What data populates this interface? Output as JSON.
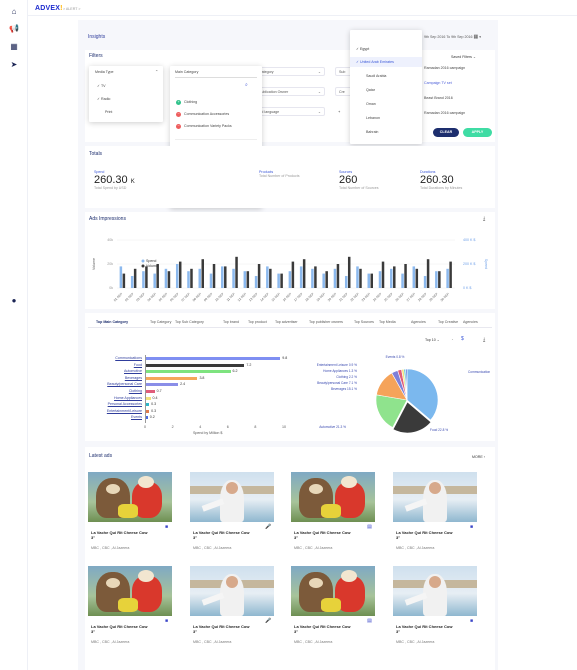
{
  "app": {
    "logo_main": "ADVEX",
    "logo_accent": "!",
    "crumb": "> ALERT >"
  },
  "sidebar": {
    "icons": [
      "home-icon",
      "megaphone-icon",
      "grid-icon",
      "send-icon",
      "user-icon"
    ]
  },
  "header": {
    "title": "Insights",
    "country": "EGYPT",
    "date_range": "9th Sep 2016 To 9th Sep 2016",
    "filters_title": "Filters",
    "saved_filters_title": "Saved Filters",
    "saved_filters": [
      "Ramadan 2016 campaign",
      "Campaign TV set",
      "Beast Brand 2016",
      "Ramadan 2016 campaign"
    ],
    "clear_label": "CLEAR",
    "apply_label": "APPLY"
  },
  "country_dd": {
    "items": [
      {
        "label": "Egypt",
        "checked": true
      },
      {
        "label": "United Arab Emirates",
        "checked": true
      },
      {
        "label": "Saudi Arabia",
        "checked": false
      },
      {
        "label": "Qatar",
        "checked": false
      },
      {
        "label": "Oman",
        "checked": false
      },
      {
        "label": "Lebanon",
        "checked": false
      },
      {
        "label": "Bahrain",
        "checked": false
      }
    ]
  },
  "media_type": {
    "label": "Media Type",
    "options": [
      {
        "label": "TV",
        "checked": true
      },
      {
        "label": "Radio",
        "checked": true
      },
      {
        "label": "Print",
        "checked": false
      }
    ]
  },
  "main_category": {
    "label": "Main Category",
    "selected": [
      {
        "label": "Clothing",
        "state": "include"
      },
      {
        "label": "Communication Accessories",
        "state": "exclude"
      },
      {
        "label": "Communication Variety Packs",
        "state": "exclude"
      }
    ],
    "list": [
      "Clothing",
      "Communication Accessories",
      "Communication Variety Packs",
      "Fixed Communication Devices",
      "Mobile Communication Devices"
    ]
  },
  "filter_pills": [
    "Category",
    "Publication Owner",
    "Ad language",
    "Sub",
    "Cre"
  ],
  "totals": {
    "title": "Totals",
    "items": [
      {
        "label": "Spend",
        "value": "260.30",
        "unit": "K",
        "sub": "Total Spend by USD"
      },
      {
        "label": "Products",
        "value": "",
        "unit": "",
        "sub": "Total Number of Products"
      },
      {
        "label": "Sources",
        "value": "260",
        "unit": "",
        "sub": "Total Number of Sources"
      },
      {
        "label": "Durations",
        "value": "260.30",
        "unit": "",
        "sub": "Total Durations by Minutes"
      }
    ]
  },
  "impressions": {
    "title": "Ads Impressions",
    "y_left_label": "Volume",
    "y_right_label": "Spend",
    "left_ticks": [
      "40k",
      "20k",
      "0k"
    ],
    "right_ticks": [
      "400 K $",
      "200 K $",
      "0 K $"
    ],
    "legend": [
      "Spend",
      "Volume"
    ],
    "x_labels": [
      "01 SEP",
      "02 SEP",
      "03 SEP",
      "04 SEP",
      "05 SEP",
      "06 SEP",
      "07 SEP",
      "08 SEP",
      "09 SEP",
      "10 SEP",
      "11 SEP",
      "12 SEP",
      "13 SEP",
      "14 SEP",
      "15 SEP",
      "16 SEP",
      "17 SEP",
      "18 SEP",
      "19 SEP",
      "20 SEP",
      "21 SEP",
      "22 SEP",
      "23 SEP",
      "24 SEP",
      "25 SEP",
      "26 SEP",
      "27 SEP",
      "28 SEP",
      "29 SEP",
      "30 SEP"
    ],
    "spend": [
      18,
      10,
      14,
      12,
      16,
      20,
      14,
      16,
      12,
      18,
      16,
      14,
      10,
      18,
      12,
      14,
      18,
      16,
      12,
      16,
      10,
      18,
      12,
      14,
      16,
      12,
      18,
      10,
      14,
      16
    ],
    "volume": [
      12,
      16,
      18,
      20,
      14,
      22,
      16,
      24,
      20,
      18,
      26,
      14,
      20,
      16,
      12,
      22,
      24,
      18,
      14,
      20,
      26,
      16,
      12,
      22,
      18,
      20,
      16,
      24,
      14,
      22
    ]
  },
  "tabs": [
    "Top Main Category",
    "Top Category",
    "Top Sub Category",
    "Top brand",
    "Top product",
    "Top advertiser",
    "Top publisher owners",
    "Top Sources",
    "Top Media",
    "Agencies",
    "Top Creative",
    "Agencies"
  ],
  "top_selector": "Top 10",
  "hbar_chart": {
    "xlabel": "Spend by Million $",
    "ticks": [
      "0",
      "2",
      "4",
      "6",
      "8",
      "10"
    ],
    "items": [
      {
        "label": "Communications",
        "value": 9.8,
        "color": "#7f8ff2"
      },
      {
        "label": "Food",
        "value": 7.2,
        "color": "#3a3a3a"
      },
      {
        "label": "Automotive",
        "value": 6.2,
        "color": "#7ee37f"
      },
      {
        "label": "Beverages",
        "value": 3.8,
        "color": "#f5a75a"
      },
      {
        "label": "Beauty/personal Care",
        "value": 2.4,
        "color": "#8a8ee8"
      },
      {
        "label": "Clothing",
        "value": 0.7,
        "color": "#e05d7a"
      },
      {
        "label": "Home Appliances",
        "value": 0.4,
        "color": "#f3e27c"
      },
      {
        "label": "Personal Accessories",
        "value": 0.3,
        "color": "#2fb5c8"
      },
      {
        "label": "Entertainment/Leisure",
        "value": 0.3,
        "color": "#e07b4e"
      },
      {
        "label": "Events",
        "value": 0.2,
        "color": "#4c6adf"
      }
    ]
  },
  "pie_chart": {
    "slices": [
      {
        "label": "Communications 38.6 %",
        "value": 38.6,
        "color": "#7bb8ee"
      },
      {
        "label": "Food 22.8 %",
        "value": 22.8,
        "color": "#3a3a3a"
      },
      {
        "label": "Automotive 21.3 %",
        "value": 21.3,
        "color": "#8fe38d"
      },
      {
        "label": "Beverages 15.1 %",
        "value": 15.1,
        "color": "#f5a35a"
      },
      {
        "label": "Beauty/personal Care 7.1 %",
        "value": 3.5,
        "color": "#7e7fd8"
      },
      {
        "label": "Clothing 2.2 %",
        "value": 2.2,
        "color": "#e05d7a"
      },
      {
        "label": "Home Appliances 1.3 %",
        "value": 1.3,
        "color": "#f3e27c"
      },
      {
        "label": "Entertainment Leisure 0.9 %",
        "value": 0.9,
        "color": "#2fb5c8"
      },
      {
        "label": "Events 0.8 %",
        "value": 0.8,
        "color": "#4c6adf"
      }
    ]
  },
  "latest_ads": {
    "title": "Latest ads",
    "more_label": "MORE",
    "cards": [
      {
        "title": "La Vache Qui Rit Cheese Cow 3\"",
        "sub": "MBC , CBC , Al Jazeera",
        "badge": "video-icon",
        "img": "puppets"
      },
      {
        "title": "La Vache Qui Rit Cheese Cow 3\"",
        "sub": "MBC , CBC , Al Jazeera",
        "badge": "mic-icon",
        "img": "man"
      },
      {
        "title": "La Vache Qui Rit Cheese Cow 3\"",
        "sub": "MBC , CBC , Al Jazeera",
        "badge": "newspaper-icon",
        "img": "puppets"
      },
      {
        "title": "La Vache Qui Rit Cheese Cow 3\"",
        "sub": "MBC , CBC , Al Jazeera",
        "badge": "video-icon",
        "img": "man"
      },
      {
        "title": "La Vache Qui Rit Cheese Cow 3\"",
        "sub": "MBC , CBC , Al Jazeera",
        "badge": "video-icon",
        "img": "puppets"
      },
      {
        "title": "La Vache Qui Rit Cheese Cow 3\"",
        "sub": "MBC , CBC , Al Jazeera",
        "badge": "mic-icon",
        "img": "man"
      },
      {
        "title": "La Vache Qui Rit Cheese Cow 3\"",
        "sub": "MBC , CBC , Al Jazeera",
        "badge": "newspaper-icon",
        "img": "puppets"
      },
      {
        "title": "La Vache Qui Rit Cheese Cow 3\"",
        "sub": "MBC , CBC , Al Jazeera",
        "badge": "video-icon",
        "img": "man"
      }
    ]
  }
}
